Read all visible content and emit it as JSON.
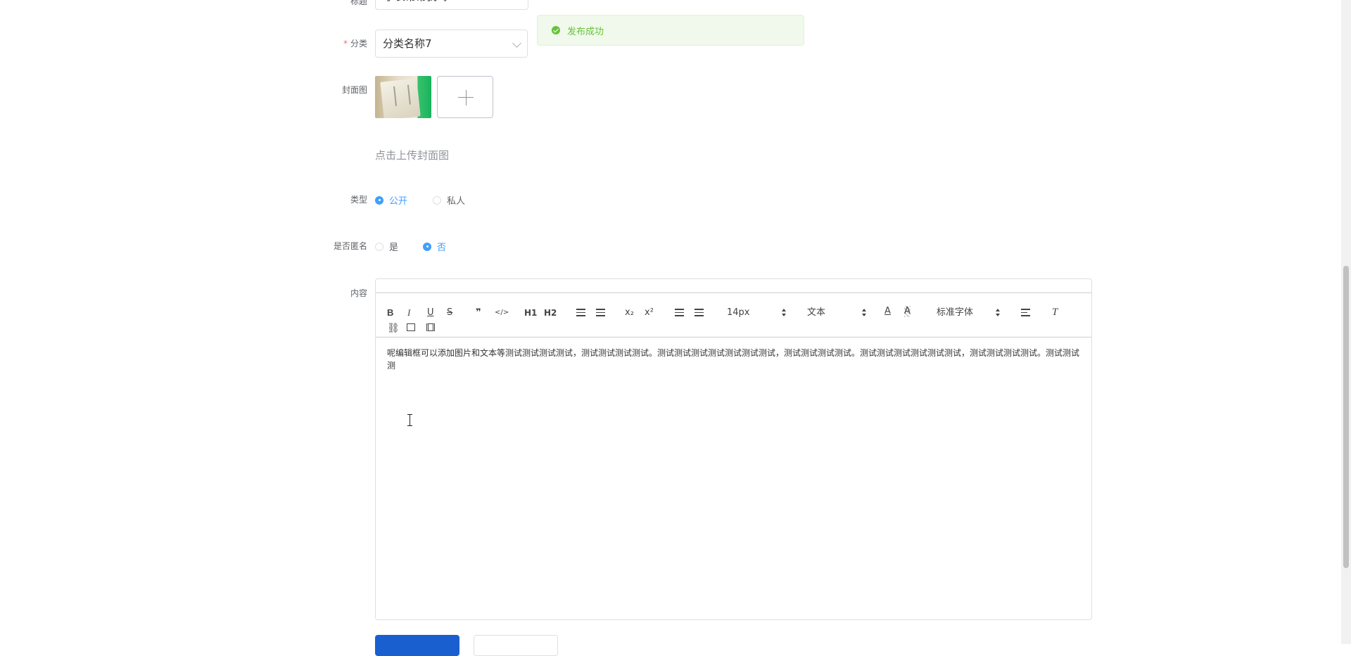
{
  "form": {
    "title": {
      "label": "标题",
      "value": "学长帮帮我吗"
    },
    "category": {
      "label": "分类",
      "value": "分类名称7"
    },
    "cover": {
      "label": "封面图",
      "hint": "点击上传封面图"
    },
    "type": {
      "label": "类型",
      "options": [
        "公开",
        "私人"
      ],
      "selected": "公开"
    },
    "anonymous": {
      "label": "是否匿名",
      "options": [
        "是",
        "否"
      ],
      "selected": "否"
    },
    "content": {
      "label": "内容",
      "text": "呢编辑框可以添加图片和文本等测试测试测试测试，测试测试测试测试。测试测试测试测试测试测试测试，测试测试测试测试。测试测试测试测试测试测试，测试测试测试测试。测试测试测"
    }
  },
  "toast": {
    "message": "发布成功"
  },
  "toolbar": {
    "buttons": [
      "B",
      "I",
      "U",
      "S",
      "❞",
      "</>",
      "H1",
      "H2",
      "x₂",
      "x²"
    ],
    "size": "14px",
    "header": "文本",
    "font": "标准字体"
  }
}
